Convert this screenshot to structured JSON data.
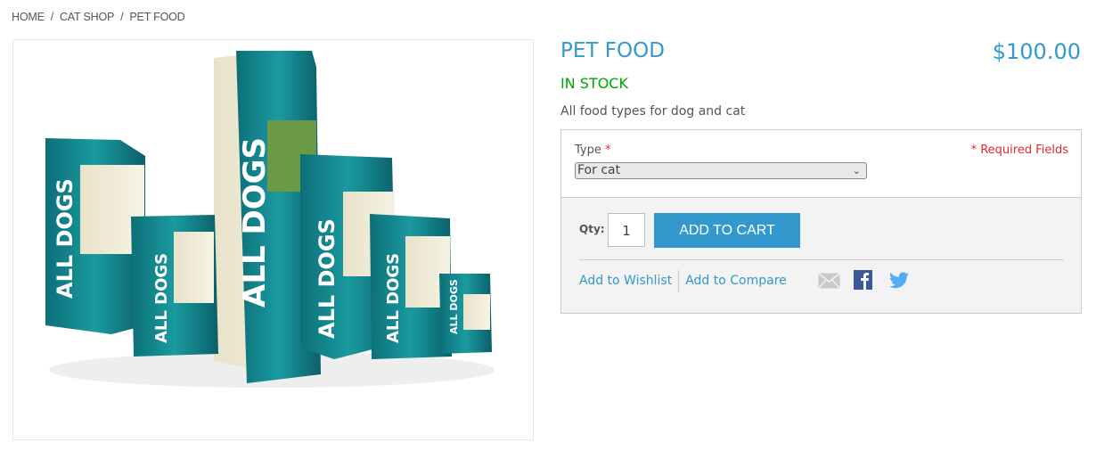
{
  "breadcrumb": [
    "HOME",
    "CAT SHOP",
    "PET FOOD"
  ],
  "product": {
    "title": "PET FOOD",
    "price": "$100.00",
    "stock": "IN STOCK",
    "description": "All food types for dog and cat",
    "image_brand_text": "ALL DOGS"
  },
  "options": {
    "type_label": "Type",
    "required_mark": "*",
    "required_fields": "* Required Fields",
    "type_value": "For cat"
  },
  "cart": {
    "qty_label": "Qty:",
    "qty_value": "1",
    "add_to_cart": "ADD TO CART",
    "wishlist": "Add to Wishlist",
    "compare": "Add to Compare"
  },
  "icons": [
    "email-icon",
    "facebook-icon",
    "twitter-icon"
  ],
  "colors": {
    "accent": "#3399cc",
    "stock": "#00a400",
    "required": "#e02b27",
    "facebook": "#3b5998",
    "twitter": "#55acee"
  }
}
